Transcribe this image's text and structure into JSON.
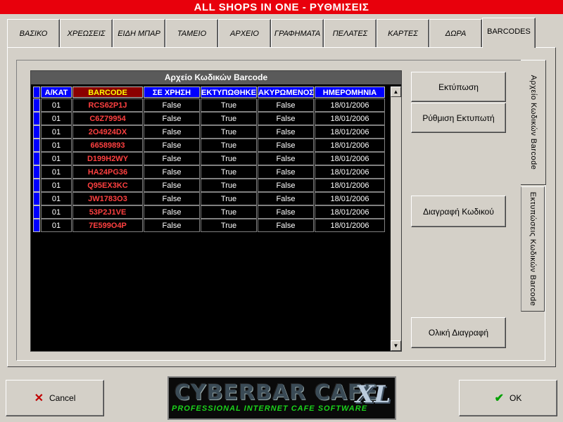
{
  "window": {
    "title": "ALL SHOPS IN ONE - ΡΥΘΜΙΣΕΙΣ"
  },
  "tabs": [
    {
      "label": "ΒΑΣΙΚΟ"
    },
    {
      "label": "ΧΡΕΩΣΕΙΣ"
    },
    {
      "label": "ΕΙΔΗ ΜΠΑΡ"
    },
    {
      "label": "ΤΑΜΕΙΟ"
    },
    {
      "label": "ΑΡΧΕΙΟ"
    },
    {
      "label": "ΓΡΑΦΗΜΑΤΑ"
    },
    {
      "label": "ΠΕΛΑΤΕΣ"
    },
    {
      "label": "ΚΑΡΤΕΣ"
    },
    {
      "label": "ΔΩΡΑ"
    },
    {
      "label": "BARCODES"
    }
  ],
  "active_tab": "BARCODES",
  "grid": {
    "title": "Αρχείο Κωδικών Barcode",
    "columns": [
      "Α/ΚΑΤ",
      "BARCODE",
      "ΣΕ ΧΡΗΣΗ",
      "ΕΚΤΥΠΩΘΗΚΕ",
      "ΑΚΥΡΩΜΕΝΟΣ",
      "ΗΜΕΡΟΜΗΝΙΑ"
    ],
    "rows": [
      [
        "01",
        "RCS62P1J",
        "False",
        "True",
        "False",
        "18/01/2006"
      ],
      [
        "01",
        "C6Z79954",
        "False",
        "True",
        "False",
        "18/01/2006"
      ],
      [
        "01",
        "2O4924DX",
        "False",
        "True",
        "False",
        "18/01/2006"
      ],
      [
        "01",
        "66589893",
        "False",
        "True",
        "False",
        "18/01/2006"
      ],
      [
        "01",
        "D199H2WY",
        "False",
        "True",
        "False",
        "18/01/2006"
      ],
      [
        "01",
        "HA24PG36",
        "False",
        "True",
        "False",
        "18/01/2006"
      ],
      [
        "01",
        "Q95EX3KC",
        "False",
        "True",
        "False",
        "18/01/2006"
      ],
      [
        "01",
        "JW1783O3",
        "False",
        "True",
        "False",
        "18/01/2006"
      ],
      [
        "01",
        "53P2J1VE",
        "False",
        "True",
        "False",
        "18/01/2006"
      ],
      [
        "01",
        "7E599O4P",
        "False",
        "True",
        "False",
        "18/01/2006"
      ]
    ]
  },
  "buttons": {
    "print": "Εκτύπωση",
    "printer_setup": "Ρύθμιση Εκτυπωτή",
    "delete_code": "Διαγραφή Κωδικού",
    "delete_all": "Ολική Διαγραφή",
    "cancel": "Cancel",
    "ok": "OK"
  },
  "side_tabs": {
    "archive": "Αρχείο Κωδικών Barcode",
    "print": "Εκτυπώσεις Κωδικών Barcode"
  },
  "logo": {
    "main": "CYBERBAR CAFE",
    "xl": "XL",
    "subtitle": "PROFESSIONAL INTERNET CAFE SOFTWARE"
  },
  "icons": {
    "cancel": "x-mark-icon",
    "ok": "check-mark-icon",
    "scroll_up": "triangle-up-icon",
    "scroll_down": "triangle-down-icon"
  },
  "colors": {
    "title_bar": "#e8000c",
    "header_blue": "#0000ff",
    "header_maroon": "#8b0000",
    "barcode_text": "#ff4040",
    "cancel_icon": "#c00000",
    "ok_icon": "#00a000"
  }
}
